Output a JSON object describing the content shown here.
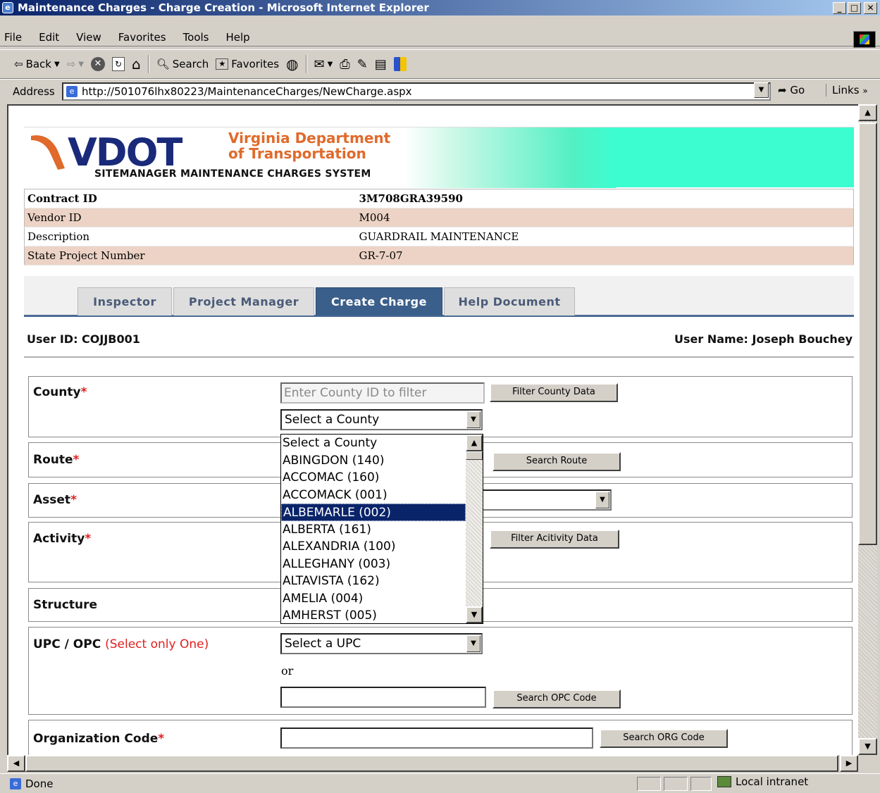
{
  "window": {
    "title": "Maintenance Charges - Charge Creation - Microsoft Internet Explorer"
  },
  "menu": [
    "File",
    "Edit",
    "View",
    "Favorites",
    "Tools",
    "Help"
  ],
  "toolbar": {
    "back": "Back",
    "search": "Search",
    "favorites": "Favorites"
  },
  "address": {
    "label": "Address",
    "url": "http://501076lhx80223/MaintenanceCharges/NewCharge.aspx",
    "go": "Go",
    "links": "Links"
  },
  "banner": {
    "logo": "VDOT",
    "org_line1": "Virginia Department",
    "org_line2": "of Transportation",
    "system": "SITEMANAGER MAINTENANCE CHARGES SYSTEM"
  },
  "info": {
    "contract_label": "Contract ID",
    "contract_value": "3M708GRA39590",
    "vendor_label": "Vendor ID",
    "vendor_value": "M004",
    "desc_label": "Description",
    "desc_value": "GUARDRAIL MAINTENANCE",
    "spn_label": "State Project Number",
    "spn_value": "GR-7-07"
  },
  "tabs": [
    "Inspector",
    "Project Manager",
    "Create Charge",
    "Help Document"
  ],
  "active_tab": "Create Charge",
  "user": {
    "id": "User ID: COJJB001",
    "name": "User Name: Joseph Bouchey"
  },
  "form": {
    "county_label": "County",
    "county_filter_placeholder": "Enter County ID to filter",
    "county_filter_btn": "Filter County Data",
    "county_select": "Select a County",
    "route_label": "Route",
    "route_btn": "Search Route",
    "asset_label": "Asset",
    "activity_label": "Activity",
    "activity_btn": "Filter Acitivity Data",
    "structure_label": "Structure",
    "upc_label": "UPC / OPC",
    "upc_note": "(Select only One)",
    "upc_select": "Select a UPC",
    "or_text": "or",
    "opc_btn": "Search OPC Code",
    "org_label": "Organization Code",
    "org_btn": "Search ORG Code",
    "required_mark": "*"
  },
  "county_options": [
    "Select a County",
    "ABINGDON (140)",
    "ACCOMAC (160)",
    "ACCOMACK (001)",
    "ALBEMARLE (002)",
    "ALBERTA (161)",
    "ALEXANDRIA (100)",
    "ALLEGHANY (003)",
    "ALTAVISTA (162)",
    "AMELIA (004)",
    "AMHERST (005)"
  ],
  "county_highlighted": "ALBEMARLE (002)",
  "status": {
    "text": "Done",
    "zone": "Local intranet"
  },
  "colors": {
    "banner_teal": "#3cfdd0",
    "logo_navy": "#1a2a7a",
    "logo_orange": "#e06a2b",
    "tab_active": "#3a5f8a",
    "row_shade": "#ecd3c5",
    "required": "#e02020",
    "selection": "#0a246a"
  }
}
